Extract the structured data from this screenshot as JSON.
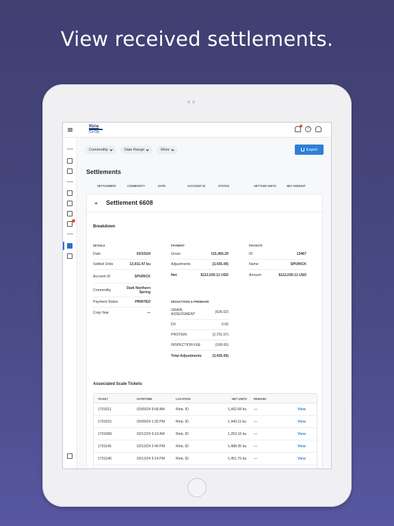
{
  "headline": "View received settlements.",
  "brand": {
    "line1": "Ririe",
    "line2": "Co-Op"
  },
  "filters": [
    {
      "label": "Commodity"
    },
    {
      "label": "Date Range"
    },
    {
      "label": "More"
    }
  ],
  "export_label": "Export",
  "page_title": "Settlements",
  "columns": [
    "SETTLEMENT",
    "COMMODITY",
    "DATE",
    "ACCOUNT ID",
    "STATUS",
    "SETTLED UNITS",
    "NET AMOUNT"
  ],
  "settlement": {
    "title": "Settlement 6608",
    "breakdown_label": "Breakdown",
    "details": {
      "label": "DETAILS",
      "rows": [
        {
          "k": "Date",
          "v": "03/15/24"
        },
        {
          "k": "Settled Units",
          "v": "13,911.47 bu"
        },
        {
          "k": "Account ID",
          "v": "SPURICK"
        },
        {
          "k": "Commodity",
          "v": "Dark Northern Spring"
        },
        {
          "k": "Payment Status",
          "v": "PRINTED"
        },
        {
          "k": "Crop Year",
          "v": "—"
        }
      ]
    },
    "payment": {
      "label": "PAYMENT",
      "rows": [
        {
          "k": "Gross",
          "v": "115,465.20"
        },
        {
          "k": "Adjustments",
          "v": "(3,435.09)"
        },
        {
          "k": "Net",
          "v": "$112,030.11 USD"
        }
      ]
    },
    "deductions": {
      "label": "DEDUCTIONS & PREMIUMS",
      "rows": [
        {
          "k": "GRAIN ASSESSMENT",
          "v": "(626.02)"
        },
        {
          "k": "DV",
          "v": "0.00"
        },
        {
          "k": "PROTEIN",
          "v": "(2,701.07)"
        },
        {
          "k": "INSPECTION FEE",
          "v": "(108.00)"
        },
        {
          "k": "Total Adjustments",
          "v": "(3,435.09)"
        }
      ]
    },
    "payouts": {
      "label": "PAYOUTS",
      "rows": [
        {
          "k": "ID",
          "v": "13467"
        },
        {
          "k": "Name",
          "v": "SPURICK"
        },
        {
          "k": "Amount",
          "v": "$112,030.11 USD"
        }
      ]
    },
    "tickets_title": "Associated Scale Tickets",
    "ticket_columns": [
      "TICKET",
      "DATE/TIME",
      "LOCATION",
      "NET UNITS",
      "REMARK"
    ],
    "tickets": [
      {
        "ticket": "1701011",
        "datetime": "02/09/24 9:58 AM",
        "location": "Ririe, ID",
        "net_units": "1,492.68 bu",
        "remark": "—",
        "action": "View"
      },
      {
        "ticket": "1701015",
        "datetime": "02/09/24 1:32 PM",
        "location": "Ririe, ID",
        "net_units": "1,443.11 bu",
        "remark": "—",
        "action": "View"
      },
      {
        "ticket": "1701068",
        "datetime": "02/12/24 9:19 AM",
        "location": "Ririe, ID",
        "net_units": "1,253.16 bu",
        "remark": "—",
        "action": "View"
      },
      {
        "ticket": "1701145",
        "datetime": "02/12/24 2:49 PM",
        "location": "Ririe, ID",
        "net_units": "1,488.35 bu",
        "remark": "—",
        "action": "View"
      },
      {
        "ticket": "1701246",
        "datetime": "02/12/24 5:14 PM",
        "location": "Ririe, ID",
        "net_units": "1,451.76 bu",
        "remark": "—",
        "action": "View"
      }
    ]
  },
  "icons": {
    "menu": "hamburger-menu-icon",
    "notifications": "bell-icon",
    "help": "help-icon",
    "account": "user-icon",
    "export": "share-icon"
  },
  "colors": {
    "accent": "#2f7fd8",
    "background": "#46468a",
    "badge": "#e54b3c"
  }
}
